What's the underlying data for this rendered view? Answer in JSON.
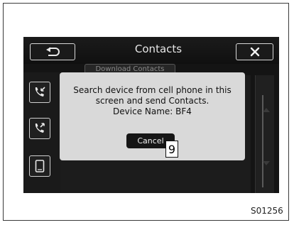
{
  "header": {
    "title": "Contacts"
  },
  "background": {
    "tab_label": "Download Contacts"
  },
  "dialog": {
    "message_line1": "Search device from cell phone in this",
    "message_line2": "screen and send Contacts.",
    "message_line3": "Device Name: BF4",
    "cancel_label": "Cancel"
  },
  "annotations": {
    "callout": "9",
    "figure_code": "S01256"
  }
}
